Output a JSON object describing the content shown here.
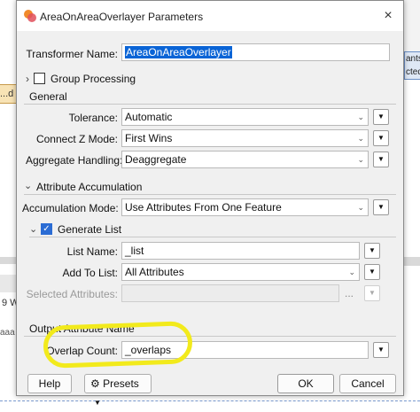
{
  "background": {
    "tag_text": "...d",
    "right_text_1": "ants",
    "right_text_2": "cted=",
    "left_label": "9 W",
    "left_dots": "aaa"
  },
  "dialog": {
    "title": "AreaOnAreaOverlayer Parameters",
    "close_icon": "×"
  },
  "transformer_name": {
    "label": "Transformer Name:",
    "value": "AreaOnAreaOverlayer"
  },
  "group_processing": {
    "label": "Group Processing",
    "expander": "›",
    "checked": false
  },
  "general": {
    "title": "General",
    "rows": [
      {
        "label": "Tolerance:",
        "value": "Automatic"
      },
      {
        "label": "Connect Z Mode:",
        "value": "First Wins"
      },
      {
        "label": "Aggregate Handling:",
        "value": "Deaggregate"
      }
    ]
  },
  "attribute_accumulation": {
    "title": "Attribute Accumulation",
    "expander": "⌄",
    "accumulation_mode": {
      "label": "Accumulation Mode:",
      "value": "Use Attributes From One Feature"
    },
    "generate_list": {
      "label": "Generate List",
      "checked": true,
      "list_name": {
        "label": "List Name:",
        "value": "_list"
      },
      "add_to_list": {
        "label": "Add To List:",
        "value": "All Attributes"
      },
      "selected_attributes": {
        "label": "Selected Attributes:",
        "value": "",
        "ellipsis": "..."
      }
    }
  },
  "output_attribute_name": {
    "title": "Output Attribute Name",
    "overlap_count": {
      "label": "Overlap Count:",
      "value": "_overlaps"
    }
  },
  "footer": {
    "help": "Help",
    "presets": "Presets",
    "ok": "OK",
    "cancel": "Cancel"
  },
  "colors": {
    "highlight": "#f2ea1c",
    "selection": "#0a64d6",
    "checkbox": "#2b6cd4"
  },
  "icons": {
    "menu": "▼",
    "dropdown": "⌄",
    "gear": "⚙"
  }
}
